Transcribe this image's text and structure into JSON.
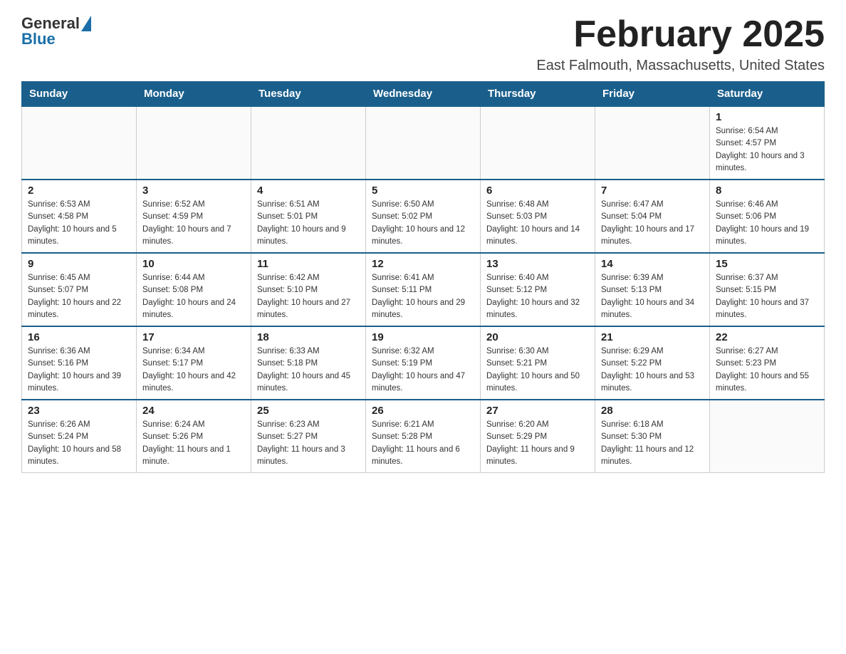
{
  "logo": {
    "general": "General",
    "blue": "Blue"
  },
  "title": {
    "month": "February 2025",
    "location": "East Falmouth, Massachusetts, United States"
  },
  "weekdays": [
    "Sunday",
    "Monday",
    "Tuesday",
    "Wednesday",
    "Thursday",
    "Friday",
    "Saturday"
  ],
  "weeks": [
    [
      {
        "day": "",
        "info": ""
      },
      {
        "day": "",
        "info": ""
      },
      {
        "day": "",
        "info": ""
      },
      {
        "day": "",
        "info": ""
      },
      {
        "day": "",
        "info": ""
      },
      {
        "day": "",
        "info": ""
      },
      {
        "day": "1",
        "info": "Sunrise: 6:54 AM\nSunset: 4:57 PM\nDaylight: 10 hours and 3 minutes."
      }
    ],
    [
      {
        "day": "2",
        "info": "Sunrise: 6:53 AM\nSunset: 4:58 PM\nDaylight: 10 hours and 5 minutes."
      },
      {
        "day": "3",
        "info": "Sunrise: 6:52 AM\nSunset: 4:59 PM\nDaylight: 10 hours and 7 minutes."
      },
      {
        "day": "4",
        "info": "Sunrise: 6:51 AM\nSunset: 5:01 PM\nDaylight: 10 hours and 9 minutes."
      },
      {
        "day": "5",
        "info": "Sunrise: 6:50 AM\nSunset: 5:02 PM\nDaylight: 10 hours and 12 minutes."
      },
      {
        "day": "6",
        "info": "Sunrise: 6:48 AM\nSunset: 5:03 PM\nDaylight: 10 hours and 14 minutes."
      },
      {
        "day": "7",
        "info": "Sunrise: 6:47 AM\nSunset: 5:04 PM\nDaylight: 10 hours and 17 minutes."
      },
      {
        "day": "8",
        "info": "Sunrise: 6:46 AM\nSunset: 5:06 PM\nDaylight: 10 hours and 19 minutes."
      }
    ],
    [
      {
        "day": "9",
        "info": "Sunrise: 6:45 AM\nSunset: 5:07 PM\nDaylight: 10 hours and 22 minutes."
      },
      {
        "day": "10",
        "info": "Sunrise: 6:44 AM\nSunset: 5:08 PM\nDaylight: 10 hours and 24 minutes."
      },
      {
        "day": "11",
        "info": "Sunrise: 6:42 AM\nSunset: 5:10 PM\nDaylight: 10 hours and 27 minutes."
      },
      {
        "day": "12",
        "info": "Sunrise: 6:41 AM\nSunset: 5:11 PM\nDaylight: 10 hours and 29 minutes."
      },
      {
        "day": "13",
        "info": "Sunrise: 6:40 AM\nSunset: 5:12 PM\nDaylight: 10 hours and 32 minutes."
      },
      {
        "day": "14",
        "info": "Sunrise: 6:39 AM\nSunset: 5:13 PM\nDaylight: 10 hours and 34 minutes."
      },
      {
        "day": "15",
        "info": "Sunrise: 6:37 AM\nSunset: 5:15 PM\nDaylight: 10 hours and 37 minutes."
      }
    ],
    [
      {
        "day": "16",
        "info": "Sunrise: 6:36 AM\nSunset: 5:16 PM\nDaylight: 10 hours and 39 minutes."
      },
      {
        "day": "17",
        "info": "Sunrise: 6:34 AM\nSunset: 5:17 PM\nDaylight: 10 hours and 42 minutes."
      },
      {
        "day": "18",
        "info": "Sunrise: 6:33 AM\nSunset: 5:18 PM\nDaylight: 10 hours and 45 minutes."
      },
      {
        "day": "19",
        "info": "Sunrise: 6:32 AM\nSunset: 5:19 PM\nDaylight: 10 hours and 47 minutes."
      },
      {
        "day": "20",
        "info": "Sunrise: 6:30 AM\nSunset: 5:21 PM\nDaylight: 10 hours and 50 minutes."
      },
      {
        "day": "21",
        "info": "Sunrise: 6:29 AM\nSunset: 5:22 PM\nDaylight: 10 hours and 53 minutes."
      },
      {
        "day": "22",
        "info": "Sunrise: 6:27 AM\nSunset: 5:23 PM\nDaylight: 10 hours and 55 minutes."
      }
    ],
    [
      {
        "day": "23",
        "info": "Sunrise: 6:26 AM\nSunset: 5:24 PM\nDaylight: 10 hours and 58 minutes."
      },
      {
        "day": "24",
        "info": "Sunrise: 6:24 AM\nSunset: 5:26 PM\nDaylight: 11 hours and 1 minute."
      },
      {
        "day": "25",
        "info": "Sunrise: 6:23 AM\nSunset: 5:27 PM\nDaylight: 11 hours and 3 minutes."
      },
      {
        "day": "26",
        "info": "Sunrise: 6:21 AM\nSunset: 5:28 PM\nDaylight: 11 hours and 6 minutes."
      },
      {
        "day": "27",
        "info": "Sunrise: 6:20 AM\nSunset: 5:29 PM\nDaylight: 11 hours and 9 minutes."
      },
      {
        "day": "28",
        "info": "Sunrise: 6:18 AM\nSunset: 5:30 PM\nDaylight: 11 hours and 12 minutes."
      },
      {
        "day": "",
        "info": ""
      }
    ]
  ]
}
